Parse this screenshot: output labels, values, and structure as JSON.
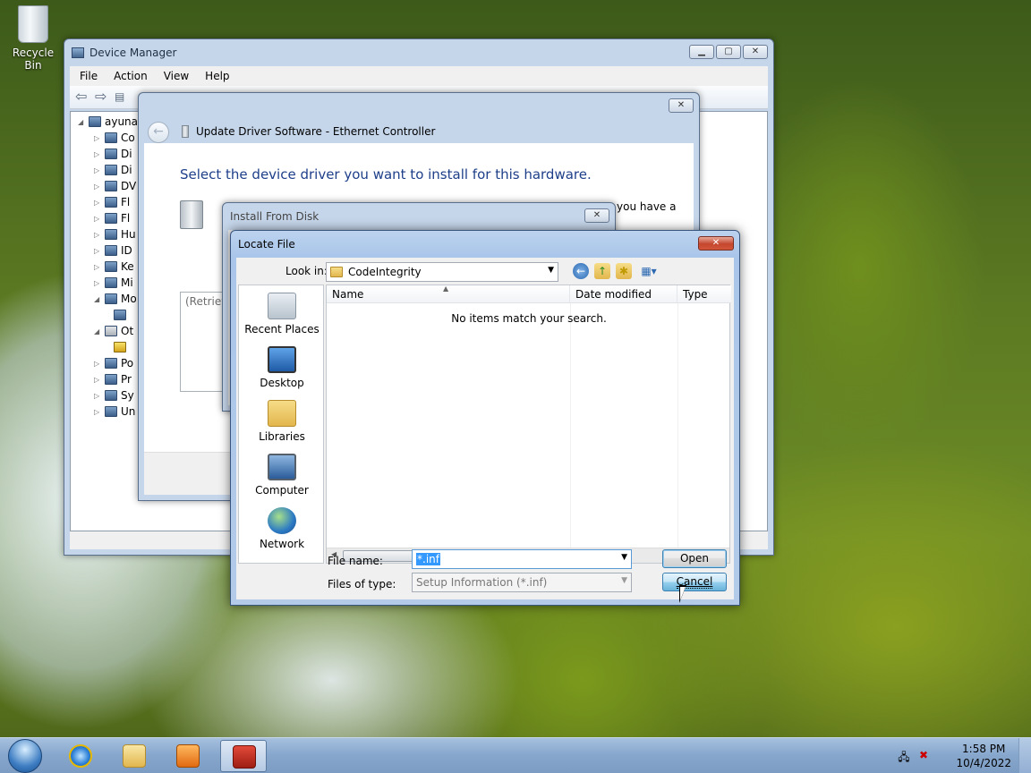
{
  "desktop": {
    "recycle_bin_label": "Recycle Bin"
  },
  "device_manager": {
    "title": "Device Manager",
    "menu": [
      "File",
      "Action",
      "View",
      "Help"
    ],
    "tree": {
      "root": "ayuna",
      "items": [
        "Co",
        "Di",
        "Di",
        "DV",
        "Fl",
        "Fl",
        "Hu",
        "ID",
        "Ke",
        "Mi",
        "Mo",
        "",
        "Ot",
        "",
        "Po",
        "Pr",
        "Sy",
        "Un"
      ]
    }
  },
  "update_driver": {
    "title": "Update Driver Software - Ethernet Controller",
    "heading": "Select the device driver you want to install for this hardware.",
    "snippet": "you have a",
    "listbox_text": "(Retrievi"
  },
  "install_from_disk": {
    "title": "Install From Disk"
  },
  "locate_file": {
    "title": "Locate File",
    "look_in_label": "Look in:",
    "look_in_value": "CodeIntegrity",
    "places": [
      "Recent Places",
      "Desktop",
      "Libraries",
      "Computer",
      "Network"
    ],
    "columns": [
      "Name",
      "Date modified",
      "Type"
    ],
    "empty_message": "No items match your search.",
    "file_name_label": "File name:",
    "file_name_value": "*.inf",
    "files_of_type_label": "Files of type:",
    "files_of_type_value": "Setup Information (*.inf)",
    "open_label": "Open",
    "cancel_label": "Cancel"
  },
  "taskbar": {
    "time": "1:58 PM",
    "date": "10/4/2022"
  }
}
